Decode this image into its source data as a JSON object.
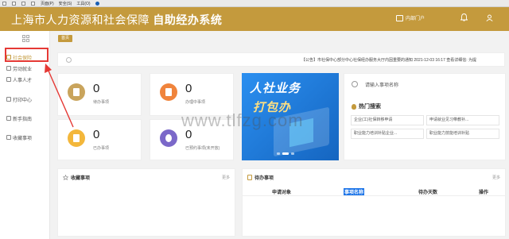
{
  "browser": {
    "items": [
      "页面(P)",
      "安全(S)",
      "工具(O)"
    ]
  },
  "header": {
    "title_prefix": "上海市人力资源和社会保障",
    "title_bold": "自助经办系统",
    "portal_label": "内部门户"
  },
  "sidebar": {
    "items": [
      {
        "label": "社会保险",
        "active": true
      },
      {
        "label": "劳动就业"
      },
      {
        "label": "人事人才"
      },
      {
        "label": "打印中心"
      },
      {
        "label": "新手指南"
      },
      {
        "label": "收藏事项"
      }
    ]
  },
  "tabs": {
    "home": "首页"
  },
  "notice": {
    "text": "【公告】市社保中心部分中心社保经办服务大厅内因重要的通知 2021-12-03 16:17 查看详细信: 为提"
  },
  "stats": [
    {
      "value": "0",
      "label": "待办事项",
      "color": "#c9a45c"
    },
    {
      "value": "0",
      "label": "办理中事项",
      "color": "#f0843c"
    },
    {
      "value": "0",
      "label": "已办事项",
      "color": "#f3b73b"
    },
    {
      "value": "0",
      "label": "已预约事项(未开放)",
      "color": "#7b68c9"
    }
  ],
  "banner": {
    "line1": "人社业务",
    "line2": "打包办"
  },
  "search": {
    "placeholder": "请输入事项名称",
    "hot_title": "热门搜索",
    "hot_items": [
      "企业(工)社保转移申请",
      "申请就业见习带教补...",
      "职业能力培训补贴企业...",
      "职业能力技能培训补贴"
    ]
  },
  "favorites": {
    "title": "收藏事项",
    "more": "更多"
  },
  "todo": {
    "title": "待办事项",
    "more": "更多",
    "columns": [
      "申请对象",
      "事项名称",
      "待办天数",
      "操作"
    ]
  },
  "watermark": "www.tlfzg.com",
  "colors": {
    "brand": "#c49a3d",
    "highlight": "#e53935"
  }
}
